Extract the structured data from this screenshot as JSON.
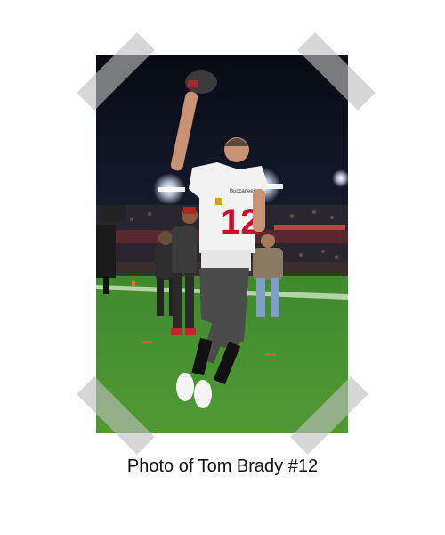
{
  "caption": "Photo of Tom Brady #12",
  "photo": {
    "subject": "football player waving cap on field at night",
    "jersey_number": "12",
    "jersey_wordmark": "Buccaneers",
    "colors": {
      "jersey": "#f2f2f2",
      "numerals": "#c8102e",
      "pants": "#4b4b4b",
      "field": "#3f8a2d",
      "sky": "#0b0f1a"
    }
  },
  "tape_color": "#bebebe"
}
